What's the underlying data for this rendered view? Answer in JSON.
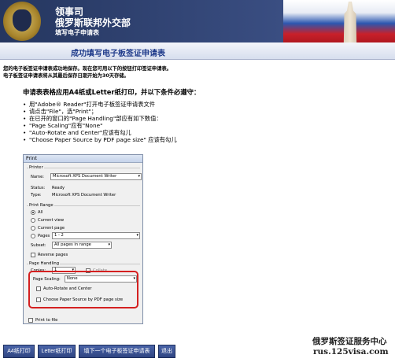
{
  "header": {
    "line1": "领事司",
    "line2": "俄罗斯联邦外交部",
    "line3": "填写电子申请表"
  },
  "page_title": "成功填写电子板签证申请表",
  "notices": [
    "您的电子板签证申请表成功地保存。现在您可用以下的按钮打印签证申请表。",
    "电子板签证申请表将从其最后保存日期开始为30天存储。"
  ],
  "instructions": {
    "title": "申请表表格应用A4纸或Letter纸打印，并以下条件必遵守：",
    "items": [
      "用\"Adobe® Reader\"打开电子板签证申请表文件",
      "请点击\"File\"，选\"Print\"；",
      "在已开的窗口的\"Page Handling\"部应有如下数值：",
      "\"Page Scaling\"应有\"None\"",
      "\"Auto-Rotate and Center\"应该有勾儿",
      "\"Choose Paper Source by PDF page size\" 应该有勾儿"
    ]
  },
  "print_dialog": {
    "title": "Print",
    "printer_group": "Printer",
    "name_label": "Name:",
    "name_value": "Microsoft XPS Document Writer",
    "status_label": "Status:",
    "status_value": "Ready",
    "type_label": "Type:",
    "type_value": "Microsoft XPS Document Writer",
    "range_group": "Print Range",
    "all": "All",
    "current_view": "Current view",
    "current_page": "Current page",
    "pages": "Pages",
    "pages_value": "1 - 2",
    "subset_label": "Subset:",
    "subset_value": "All pages in range",
    "reverse_pages": "Reverse pages",
    "handling_group": "Page Handling",
    "copies_label": "Copies:",
    "copies_value": "1",
    "collate": "Collate",
    "scaling_label": "Page Scaling:",
    "scaling_value": "None",
    "auto_rotate": "Auto-Rotate and Center",
    "choose_paper": "Choose Paper Source by PDF page size",
    "print_to_file": "Print to file"
  },
  "buttons": {
    "a4": "A4纸打印",
    "letter": "Letter纸打印",
    "next": "填下一个电子板签证申请表",
    "exit": "退出"
  },
  "watermark": {
    "line1": "俄罗斯签证服务中心",
    "line2": "rus.125visa.com"
  }
}
